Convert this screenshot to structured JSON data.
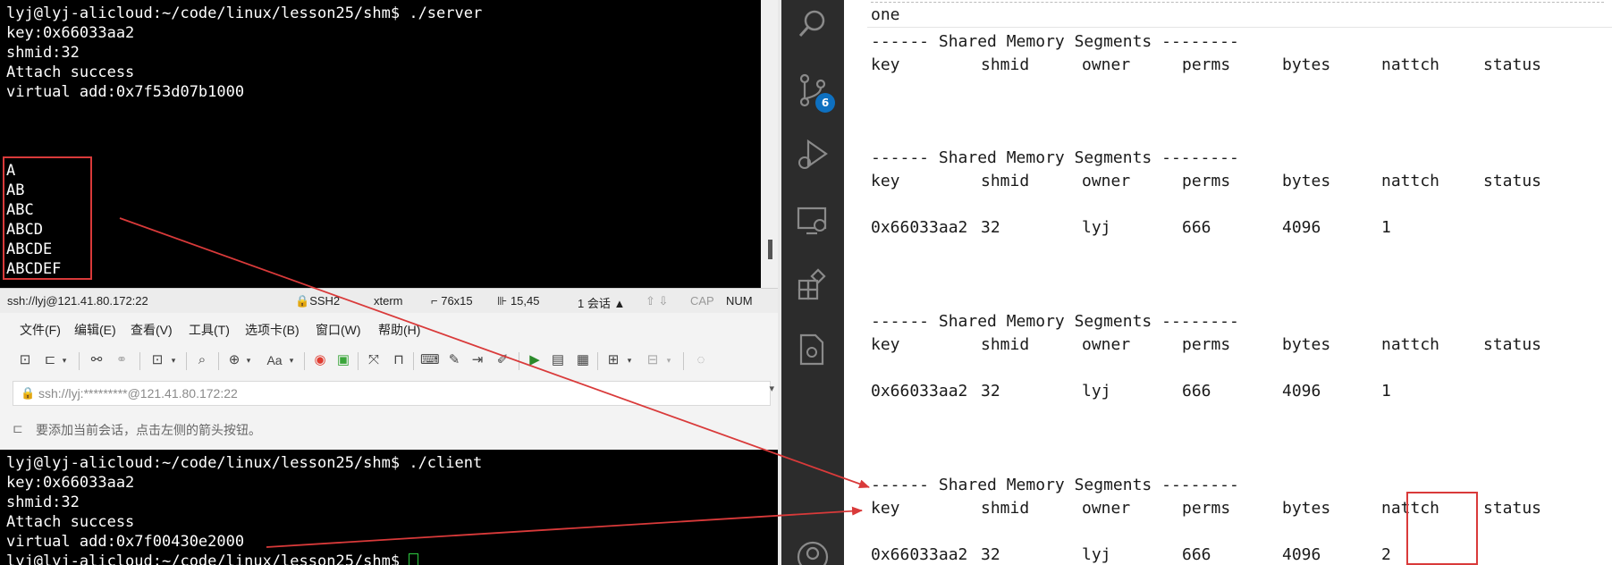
{
  "left_terminal_top": {
    "lines": [
      "lyj@lyj-alicloud:~/code/linux/lesson25/shm$ ./server",
      "key:0x66033aa2",
      "shmid:32",
      "Attach success",
      "virtual add:0x7f53d07b1000",
      "",
      "",
      "",
      "A",
      "AB",
      "ABC",
      "ABCD",
      "ABCDE",
      "ABCDEF"
    ]
  },
  "status_bar": {
    "connection": "ssh://lyj@121.41.80.172:22",
    "protocol": "SSH2",
    "terminal_type": "xterm",
    "size": "76x15",
    "cursor_pos": "15,45",
    "sessions": "1 会话",
    "caps": "CAP",
    "num": "NUM"
  },
  "menu": {
    "items": [
      "文件(F)",
      "编辑(E)",
      "查看(V)",
      "工具(T)",
      "选项卡(B)",
      "窗口(W)",
      "帮助(H)"
    ]
  },
  "toolbar": {
    "font_label": "Aa"
  },
  "address_bar": {
    "value": "ssh://lyj:*********@121.41.80.172:22"
  },
  "hint_bar": {
    "text": "要添加当前会话，点击左侧的箭头按钮。"
  },
  "left_terminal_bottom": {
    "lines": [
      "lyj@lyj-alicloud:~/code/linux/lesson25/shm$ ./client",
      "key:0x66033aa2",
      "shmid:32",
      "Attach success",
      "virtual add:0x7f00430e2000",
      "lyj@lyj-alicloud:~/code/linux/lesson25/shm$ "
    ]
  },
  "activity_bar": {
    "source_control_badge": "6"
  },
  "right_terminal": {
    "top_fragment": "one",
    "header_title": "------ Shared Memory Segments --------",
    "columns": [
      "key",
      "shmid",
      "owner",
      "perms",
      "bytes",
      "nattch",
      "status"
    ],
    "blocks": [
      {
        "rows": []
      },
      {
        "rows": [
          [
            "0x66033aa2",
            "32",
            "lyj",
            "666",
            "4096",
            "1",
            ""
          ]
        ]
      },
      {
        "rows": [
          [
            "0x66033aa2",
            "32",
            "lyj",
            "666",
            "4096",
            "1",
            ""
          ]
        ]
      },
      {
        "rows": [
          [
            "0x66033aa2",
            "32",
            "lyj",
            "666",
            "4096",
            "2",
            ""
          ]
        ]
      }
    ]
  },
  "colors": {
    "annotation_red": "#d93a3a",
    "badge_blue": "#0e70c0",
    "cursor_green": "#2ecc40"
  }
}
